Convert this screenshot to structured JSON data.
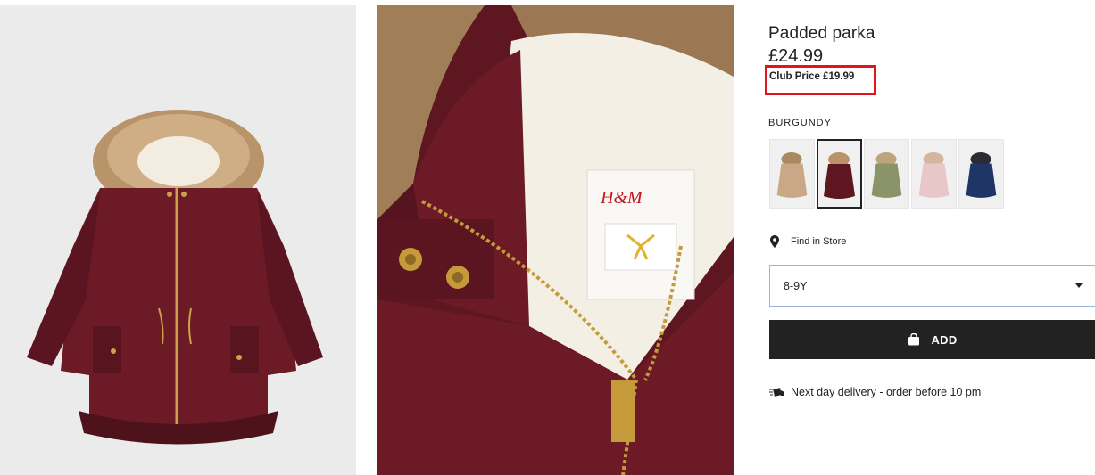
{
  "product": {
    "title": "Padded parka",
    "price": "£24.99",
    "club_price": "Club Price £19.99",
    "colour_label": "BURGUNDY",
    "swatches": [
      {
        "name": "beige",
        "color": "#c9a887"
      },
      {
        "name": "burgundy",
        "color": "#5e1721"
      },
      {
        "name": "khaki green",
        "color": "#8a9468"
      },
      {
        "name": "light pink",
        "color": "#e9c7c9"
      },
      {
        "name": "dark blue",
        "color": "#1f3566"
      }
    ],
    "selected_swatch": "burgundy"
  },
  "store": {
    "label": "Find in Store",
    "icon": "location-pin-icon"
  },
  "size_select": {
    "selected": "8-9Y"
  },
  "add_button": {
    "label": "ADD",
    "icon": "shopping-bag-icon"
  },
  "delivery": {
    "text": "Next day delivery - order before 10 pm",
    "icon": "delivery-truck-icon"
  },
  "detail_image": {
    "brand_label": "H&M"
  },
  "colors": {
    "accent_highlight": "#e1141c",
    "button_bg": "#222222",
    "select_border": "#9ab6dc"
  }
}
